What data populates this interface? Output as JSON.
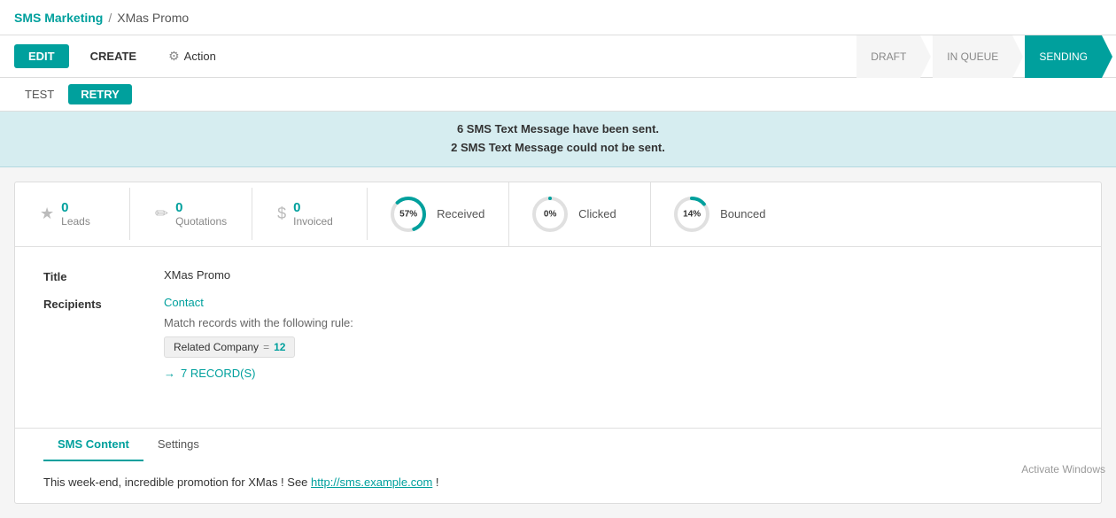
{
  "breadcrumb": {
    "app": "SMS Marketing",
    "separator": "/",
    "page": "XMas Promo"
  },
  "toolbar": {
    "edit_label": "EDIT",
    "create_label": "CREATE",
    "action_label": "Action"
  },
  "sub_toolbar": {
    "test_label": "TEST",
    "retry_label": "RETRY"
  },
  "status_steps": [
    {
      "label": "DRAFT",
      "active": false
    },
    {
      "label": "IN QUEUE",
      "active": false
    },
    {
      "label": "SENDING",
      "active": true
    }
  ],
  "alert": {
    "line1": "6  SMS Text Message have been sent.",
    "line2": "2  SMS Text Message could not be sent."
  },
  "stats": [
    {
      "type": "icon",
      "icon": "★",
      "number": "0",
      "label": "Leads"
    },
    {
      "type": "icon",
      "icon": "✏",
      "number": "0",
      "label": "Quotations"
    },
    {
      "type": "icon",
      "icon": "$",
      "number": "0",
      "label": "Invoiced"
    },
    {
      "type": "circle",
      "pct": 57,
      "label": "Received",
      "color": "#00a09d",
      "bg": "#e0e0e0"
    },
    {
      "type": "circle",
      "pct": 0,
      "label": "Clicked",
      "color": "#00a09d",
      "bg": "#e0e0e0"
    },
    {
      "type": "circle",
      "pct": 14,
      "label": "Bounced",
      "color": "#00a09d",
      "bg": "#e0e0e0"
    }
  ],
  "form": {
    "title_label": "Title",
    "title_value": "XMas Promo",
    "recipients_label": "Recipients",
    "recipients_value": "Contact",
    "rule_text": "Match records with the following rule:",
    "rule_field": "Related Company",
    "rule_op": "=",
    "rule_val": "12",
    "records_count": "7 RECORD(S)"
  },
  "tabs": [
    {
      "label": "SMS Content",
      "active": true
    },
    {
      "label": "Settings",
      "active": false
    }
  ],
  "sms_content": "This week-end, incredible promotion for XMas ! See http://sms.example.com !",
  "watermark": "Activate Windows"
}
